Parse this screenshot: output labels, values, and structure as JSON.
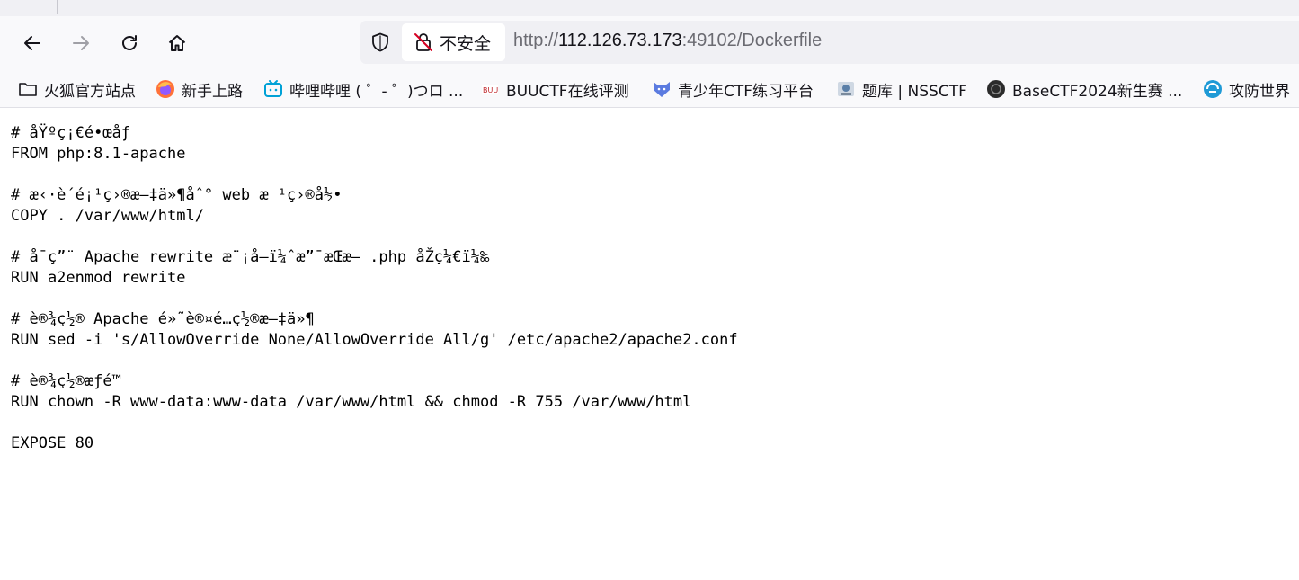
{
  "browser": {
    "security_label": "不安全",
    "url_scheme": "http://",
    "url_host": "112.126.73.173",
    "url_rest": ":49102/Dockerfile",
    "accent_color": "#15141a"
  },
  "bookmarks": [
    {
      "label": "火狐官方站点",
      "icon": "folder-icon"
    },
    {
      "label": "新手上路",
      "icon": "firefox-icon"
    },
    {
      "label": "哔哩哔哩 ( ゜- ゜)つロ ...",
      "icon": "bilibili-icon"
    },
    {
      "label": "BUUCTF在线评测",
      "icon": "buuctf-icon"
    },
    {
      "label": "青少年CTF练习平台",
      "icon": "fox-icon"
    },
    {
      "label": "题库 | NSSCTF",
      "icon": "nssctf-icon"
    },
    {
      "label": "BaseCTF2024新生赛 ...",
      "icon": "basectf-icon"
    },
    {
      "label": "攻防世界",
      "icon": "adworld-icon"
    }
  ],
  "document": {
    "lines": [
      "# åŸºç¡€é•œåƒ",
      "FROM php:8.1-apache",
      "",
      "# æ‹·è´é¡¹ç›®æ–‡ä»¶åˆ° web æ ¹ç›®å½•",
      "COPY . /var/www/html/",
      "",
      "# å¯ç”¨ Apache rewrite æ¨¡å—ï¼ˆæ”¯æŒæ— .php åŽç¼€ï¼‰",
      "RUN a2enmod rewrite",
      "",
      "# è®¾ç½® Apache é»˜è®¤é…ç½®æ–‡ä»¶",
      "RUN sed -i 's/AllowOverride None/AllowOverride All/g' /etc/apache2/apache2.conf",
      "",
      "# è®¾ç½®æƒé™",
      "RUN chown -R www-data:www-data /var/www/html && chmod -R 755 /var/www/html",
      "",
      "EXPOSE 80"
    ]
  }
}
